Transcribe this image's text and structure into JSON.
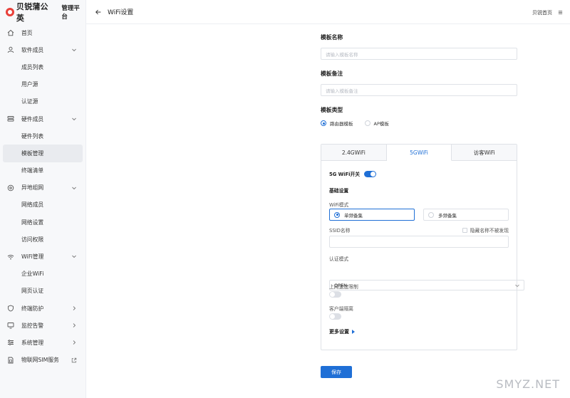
{
  "brand": {
    "name": "贝锐蒲公英",
    "subtitle": "管理平台"
  },
  "sidebar": {
    "items": [
      {
        "label": "首页",
        "icon": "home-icon",
        "sub": false
      },
      {
        "label": "软件成员",
        "icon": "user-icon",
        "sub": false,
        "arrow": "chevron-down-icon"
      },
      {
        "label": "成员列表",
        "sub": true
      },
      {
        "label": "用户源",
        "sub": true
      },
      {
        "label": "认证源",
        "sub": true
      },
      {
        "label": "硬件成员",
        "icon": "stack-icon",
        "sub": false,
        "arrow": "chevron-down-icon"
      },
      {
        "label": "硬件列表",
        "sub": true
      },
      {
        "label": "模板管理",
        "sub": true,
        "active": true
      },
      {
        "label": "终端清单",
        "sub": true
      },
      {
        "label": "异地组网",
        "icon": "network-icon",
        "sub": false,
        "arrow": "chevron-down-icon"
      },
      {
        "label": "网络成员",
        "sub": true
      },
      {
        "label": "网络设置",
        "sub": true
      },
      {
        "label": "访问权限",
        "sub": true
      },
      {
        "label": "WiFi管理",
        "icon": "wifi-icon",
        "sub": false,
        "arrow": "chevron-down-icon"
      },
      {
        "label": "企业WiFi",
        "sub": true
      },
      {
        "label": "网页认证",
        "sub": true
      },
      {
        "label": "终端防护",
        "icon": "shield-icon",
        "sub": false,
        "arrow": "chevron-right-icon"
      },
      {
        "label": "监控告警",
        "icon": "monitor-icon",
        "sub": false,
        "arrow": "chevron-right-icon"
      },
      {
        "label": "系统管理",
        "icon": "sliders-icon",
        "sub": false,
        "arrow": "chevron-right-icon"
      },
      {
        "label": "物联网SIM服务",
        "icon": "sim-icon",
        "sub": false,
        "arrow": "external-link-icon"
      }
    ]
  },
  "header": {
    "title": "WiFi设置",
    "home_link": "贝锐首页"
  },
  "form": {
    "template_name_label": "模板名称",
    "template_name_placeholder": "请输入模板名称",
    "template_note_label": "模板备注",
    "template_note_placeholder": "请输入模板备注",
    "template_type_label": "模板类型",
    "type_options": [
      "路由器模板",
      "AP模板"
    ],
    "type_selected": "路由器模板"
  },
  "tabs": {
    "items": [
      "2.4GWiFi",
      "5GWiFi",
      "访客WiFi"
    ],
    "active": "5GWiFi"
  },
  "wifi5g": {
    "switch_label": "5G WiFi开关",
    "switch_on": true,
    "basic_settings": "基础设置",
    "mode_label": "WiFi模式",
    "mode_options": [
      "单频备集",
      "多频备集"
    ],
    "mode_selected": "单频备集",
    "ssid_label": "SSID名称",
    "hide_ssid_label": "隐藏名称不被发现",
    "auth_label": "认证模式",
    "auth_value": "OPEN",
    "uplink_label": "上网速度限制",
    "uplink_on": false,
    "isolation_label": "客户端隔离",
    "isolation_on": false,
    "more_label": "更多设置"
  },
  "save_label": "保存",
  "watermark": "SMYZ.NET"
}
